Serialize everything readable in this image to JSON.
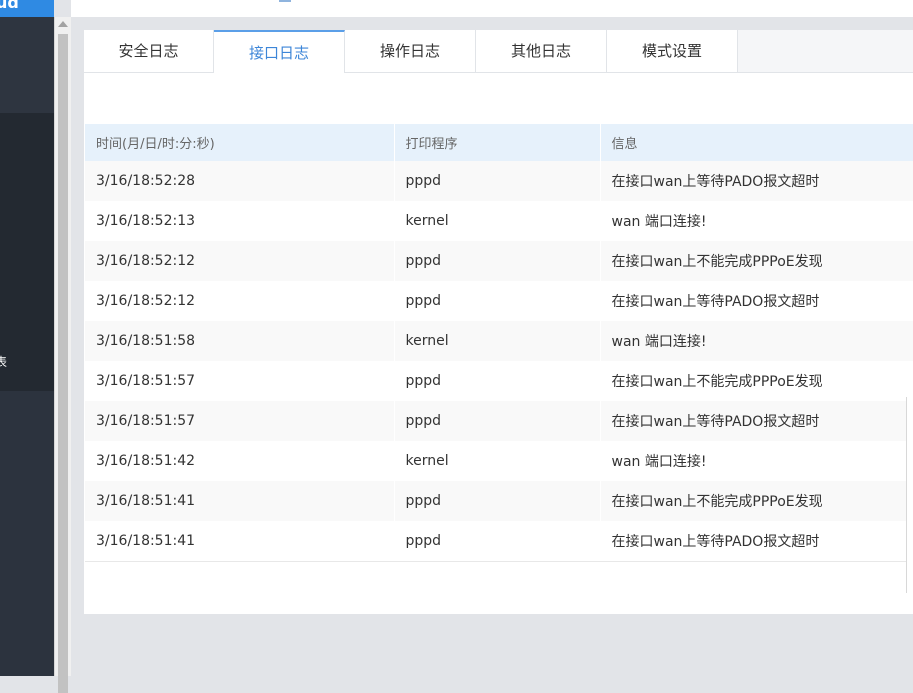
{
  "brand": "cloud",
  "sidebar": {
    "label": "表"
  },
  "tabs": [
    {
      "label": "安全日志"
    },
    {
      "label": "接口日志"
    },
    {
      "label": "操作日志"
    },
    {
      "label": "其他日志"
    },
    {
      "label": "模式设置"
    }
  ],
  "active_tab": "接口日志",
  "table": {
    "headers": [
      "时间(月/日/时:分:秒)",
      "打印程序",
      "信息"
    ],
    "rows": [
      [
        "3/16/18:52:28",
        "pppd",
        "在接口wan上等待PADO报文超时"
      ],
      [
        "3/16/18:52:13",
        "kernel",
        "wan 端口连接!"
      ],
      [
        "3/16/18:52:12",
        "pppd",
        "在接口wan上不能完成PPPoE发现"
      ],
      [
        "3/16/18:52:12",
        "pppd",
        "在接口wan上等待PADO报文超时"
      ],
      [
        "3/16/18:51:58",
        "kernel",
        "wan 端口连接!"
      ],
      [
        "3/16/18:51:57",
        "pppd",
        "在接口wan上不能完成PPPoE发现"
      ],
      [
        "3/16/18:51:57",
        "pppd",
        "在接口wan上等待PADO报文超时"
      ],
      [
        "3/16/18:51:42",
        "kernel",
        "wan 端口连接!"
      ],
      [
        "3/16/18:51:41",
        "pppd",
        "在接口wan上不能完成PPPoE发现"
      ],
      [
        "3/16/18:51:41",
        "pppd",
        "在接口wan上等待PADO报文超时"
      ]
    ]
  },
  "colors": {
    "accent": "#3d86d8",
    "brand": "#2f8ae3",
    "sidebar": "#2c333e",
    "header_row": "#e6f1fb"
  }
}
